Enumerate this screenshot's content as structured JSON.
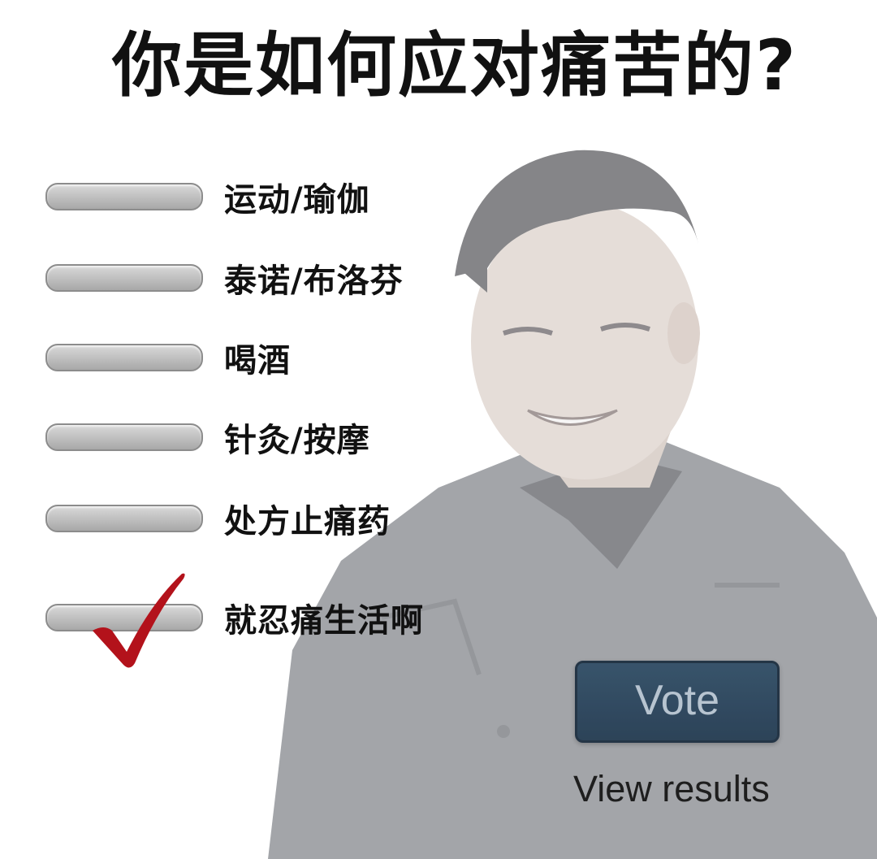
{
  "poll": {
    "question": "你是如何应对痛苦的?",
    "options": [
      {
        "label": "运动/瑜伽",
        "selected": false
      },
      {
        "label": "泰诺/布洛芬",
        "selected": false
      },
      {
        "label": "喝酒",
        "selected": false
      },
      {
        "label": "针灸/按摩",
        "selected": false
      },
      {
        "label": "处方止痛药",
        "selected": false
      },
      {
        "label": "就忍痛生活啊",
        "selected": true
      }
    ],
    "vote_label": "Vote",
    "view_results_label": "View results"
  },
  "colors": {
    "vote_button": "#2a4560",
    "checkmark": "#b3121b",
    "pill": "#bdbdbd"
  },
  "icons": {
    "selection_marker": "checkmark-icon"
  }
}
